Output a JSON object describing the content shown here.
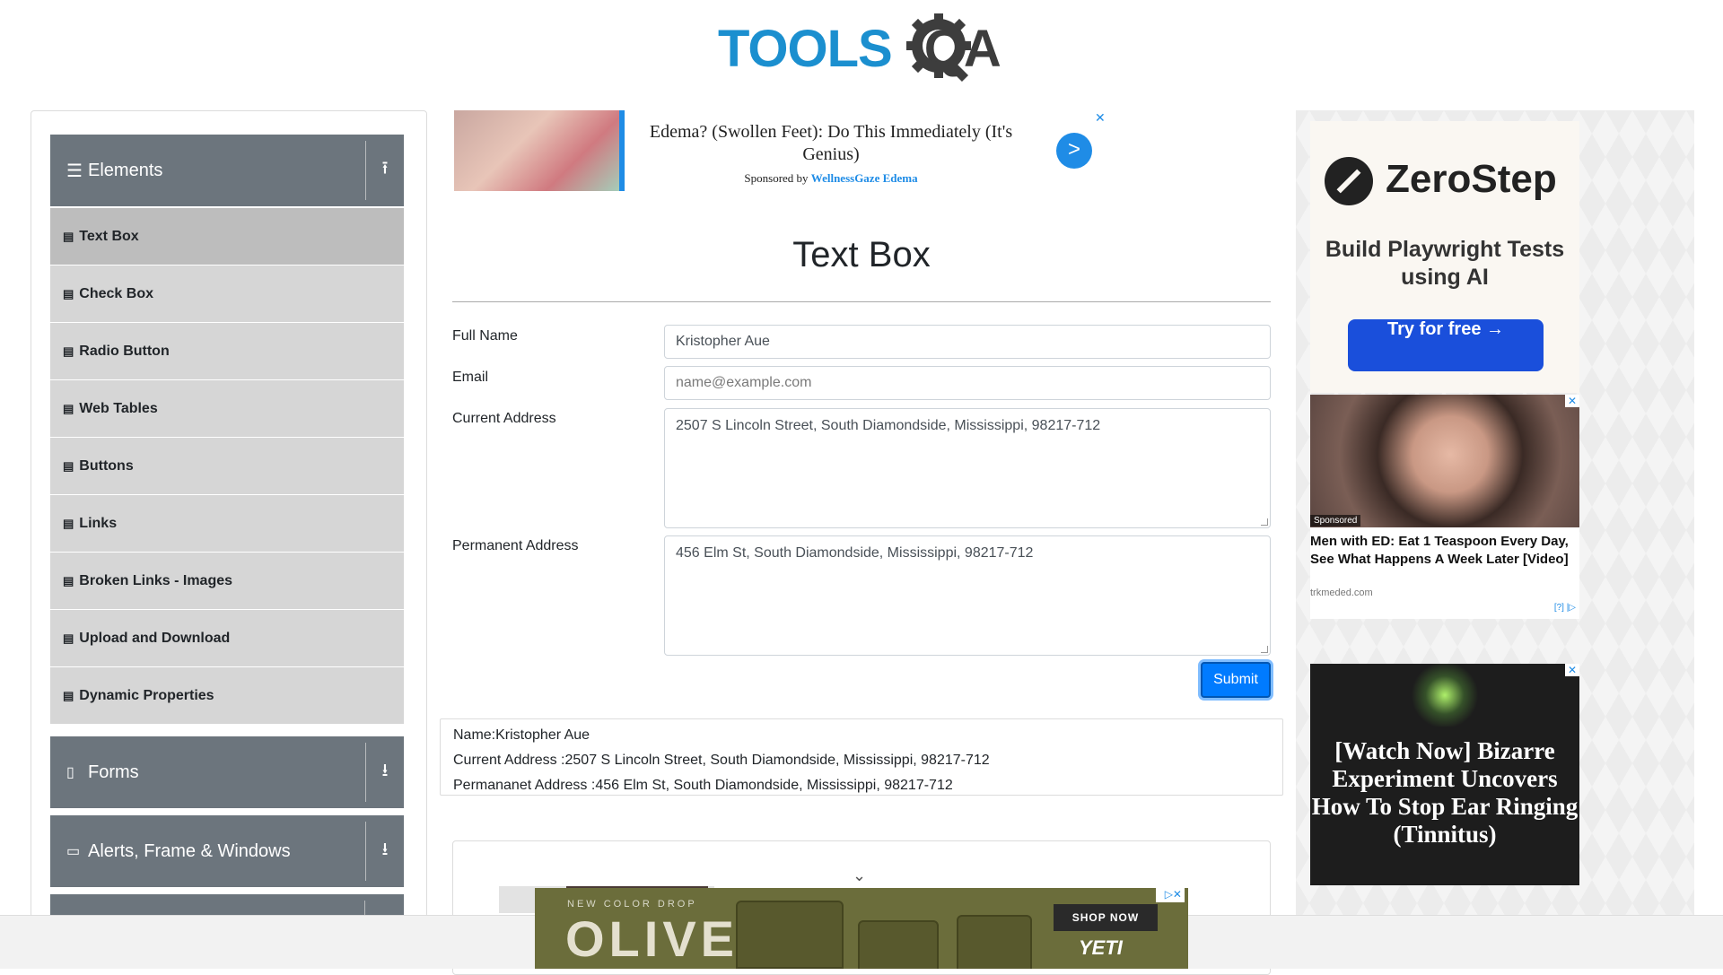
{
  "header": {
    "logo_tools": "TOOLS",
    "logo_qa": "QA"
  },
  "sidebar": {
    "groups": [
      {
        "label": "Elements",
        "icon": "hamburger-icon",
        "toggle": "collapse-up-icon"
      },
      {
        "label": "Forms",
        "icon": "form-icon",
        "toggle": "expand-down-icon"
      },
      {
        "label": "Alerts, Frame & Windows",
        "icon": "window-icon",
        "toggle": "expand-down-icon"
      }
    ],
    "items": [
      {
        "label": "Text Box",
        "active": true
      },
      {
        "label": "Check Box"
      },
      {
        "label": "Radio Button"
      },
      {
        "label": "Web Tables"
      },
      {
        "label": "Buttons"
      },
      {
        "label": "Links"
      },
      {
        "label": "Broken Links - Images"
      },
      {
        "label": "Upload and Download"
      },
      {
        "label": "Dynamic Properties"
      }
    ]
  },
  "top_ad": {
    "title": "Edema? (Swollen Feet): Do This Immediately (It's Genius)",
    "sponsored_prefix": "Sponsored by",
    "sponsor": "WellnessGaze Edema",
    "arrow": ">",
    "close": "✕"
  },
  "form": {
    "title": "Text Box",
    "full_name_label": "Full Name",
    "full_name_value": "Kristopher Aue",
    "email_label": "Email",
    "email_placeholder": "name@example.com",
    "current_address_label": "Current Address",
    "current_address_value": "2507 S Lincoln Street, South Diamondside, Mississippi, 98217-712",
    "permanent_address_label": "Permanent Address",
    "permanent_address_value": "456 Elm St, South Diamondside, Mississippi, 98217-712",
    "submit_label": "Submit"
  },
  "output": {
    "name": "Name:Kristopher Aue",
    "current_address": "Current Address :2507 S Lincoln Street, South Diamondside, Mississippi, 98217-712",
    "permanent_address": "Permananet Address :456 Elm St, South Diamondside, Mississippi, 98217-712"
  },
  "right_ads": {
    "zerostep": {
      "name": "ZeroStep",
      "tagline": "Build Playwright Tests using AI",
      "button": "Try for free →"
    },
    "ed": {
      "sponsored": "Sponsored",
      "title": "Men with ED: Eat 1 Teaspoon Every Day, See What Happens A Week Later [Video]",
      "source": "trkmeded.com",
      "marker": "[?] |▷",
      "close": "✕"
    },
    "tinnitus": {
      "title": "[Watch Now] Bizarre Experiment Uncovers How To Stop Ear Ringing (Tinnitus)",
      "close": "✕"
    }
  },
  "bottom_ad": {
    "small": "NEW COLOR DROP",
    "headline": "OLIVE",
    "shop": "SHOP NOW",
    "brand": "YETI",
    "close": "▷✕"
  }
}
